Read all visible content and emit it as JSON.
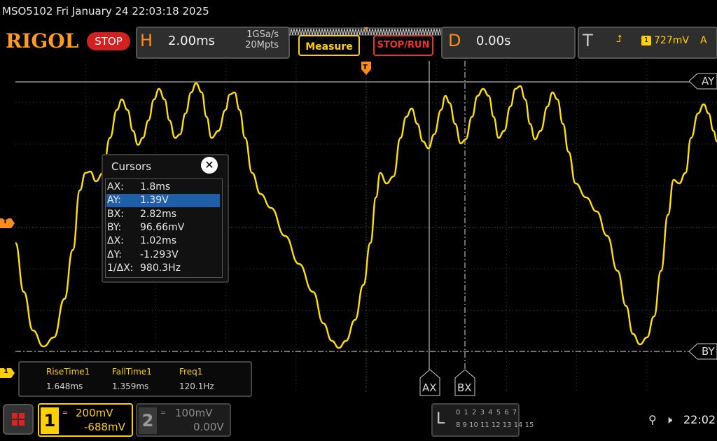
{
  "titlebar": {
    "text": "MSO5102  Fri January 24 22:03:18 2025"
  },
  "logo": "RIGOL",
  "run_state": "STOP",
  "horizontal": {
    "letter": "H",
    "timebase": "2.00ms",
    "sample_rate": "1GSa/s",
    "memory_depth": "20Mpts"
  },
  "buttons": {
    "measure": "Measure",
    "stop_run": "STOP/RUN"
  },
  "delay": {
    "letter": "D",
    "value": "0.00s"
  },
  "trigger": {
    "letter": "T",
    "source": "1",
    "level": "727mV",
    "mode": "A",
    "edge_icon": "rising-edge-icon"
  },
  "markers": {
    "trigger_pos": "T",
    "trigger_level": "T",
    "ch1_ground": "1"
  },
  "cursors": {
    "title": "Cursors",
    "rows": [
      {
        "key": "AX:",
        "value": "1.8ms"
      },
      {
        "key": "AY:",
        "value": "1.39V",
        "selected": true
      },
      {
        "key": "BX:",
        "value": "2.82ms"
      },
      {
        "key": "BY:",
        "value": "96.66mV"
      },
      {
        "key": "ΔX:",
        "value": "1.02ms"
      },
      {
        "key": "ΔY:",
        "value": "-1.293V"
      },
      {
        "key": "1/ΔX:",
        "value": "980.3Hz"
      }
    ],
    "labels": {
      "ax": "AX",
      "bx": "BX",
      "ay": "AY",
      "by": "BY"
    }
  },
  "measurements": [
    {
      "name": "RiseTime1",
      "value": "1.648ms"
    },
    {
      "name": "FallTime1",
      "value": "1.359ms"
    },
    {
      "name": "Freq1",
      "value": "120.1Hz"
    }
  ],
  "channels": {
    "ch1": {
      "num": "1",
      "scale": "200mV",
      "offset": "-688mV",
      "color": "#ffd000"
    },
    "ch2": {
      "num": "2",
      "scale": "100mV",
      "offset": "0.00V"
    }
  },
  "logic": {
    "letter": "L",
    "row1": "0 1 2 3  4 5 6 7",
    "row2": "8 9 10 11 12 13 14 15"
  },
  "status": {
    "clock": "22:02"
  }
}
